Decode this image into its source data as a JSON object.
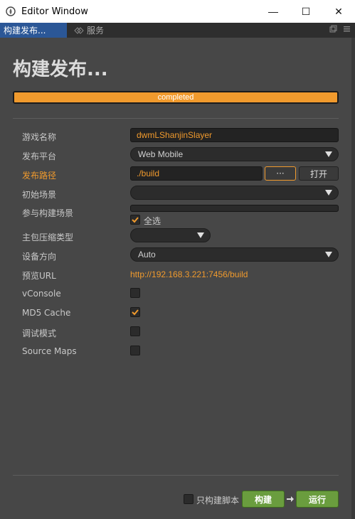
{
  "window": {
    "title": "Editor Window",
    "minimize_glyph": "—",
    "maximize_glyph": "☐",
    "close_glyph": "✕"
  },
  "tabs": [
    {
      "label": "构建发布...",
      "active": true
    },
    {
      "label": "服务",
      "active": false
    }
  ],
  "page": {
    "title": "构建发布..."
  },
  "progress": {
    "label": "completed",
    "percent": 100
  },
  "form": {
    "game_name_label": "游戏名称",
    "game_name_value": "dwmLShanjinSlayer",
    "platform_label": "发布平台",
    "platform_value": "Web Mobile",
    "build_path_label": "发布路径",
    "build_path_value": "./build",
    "browse_label": "···",
    "open_label": "打开",
    "start_scene_label": "初始场景",
    "start_scene_value": "",
    "scenes_label": "参与构建场景",
    "select_all_label": "全选",
    "select_all_checked": true,
    "compression_label": "主包压缩类型",
    "compression_value": "",
    "orientation_label": "设备方向",
    "orientation_value": "Auto",
    "preview_url_label": "预览URL",
    "preview_url_value": "http://192.168.3.221:7456/build",
    "vconsole_label": "vConsole",
    "vconsole_checked": false,
    "md5_label": "MD5 Cache",
    "md5_checked": true,
    "debug_label": "调试模式",
    "debug_checked": false,
    "sourcemaps_label": "Source Maps",
    "sourcemaps_checked": false
  },
  "footer": {
    "script_only_label": "只构建脚本",
    "script_only_checked": false,
    "build_label": "构建",
    "run_label": "运行"
  },
  "colors": {
    "accent": "#f09a2d",
    "panel_bg": "#474747",
    "tab_active": "#2b5797",
    "green": "#6a9d3e"
  }
}
